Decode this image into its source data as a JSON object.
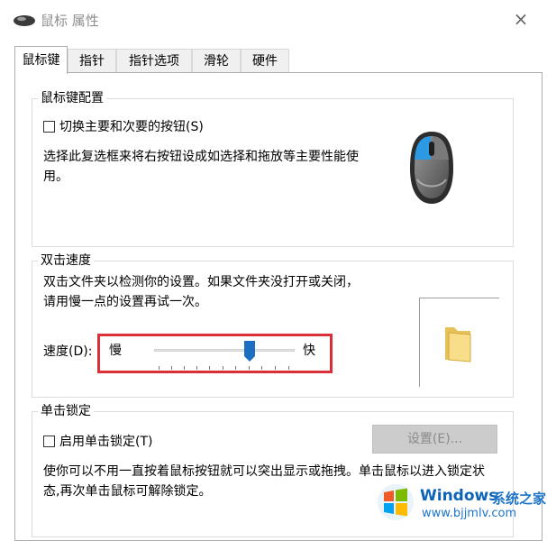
{
  "window": {
    "title": "鼠标 属性",
    "close_glyph": "×"
  },
  "tabs": [
    {
      "label": "鼠标键",
      "active": true
    },
    {
      "label": "指针"
    },
    {
      "label": "指针选项"
    },
    {
      "label": "滑轮"
    },
    {
      "label": "硬件"
    }
  ],
  "button_config": {
    "group_title": "鼠标键配置",
    "checkbox_label": "切换主要和次要的按钮(S)",
    "checked": false,
    "description": "选择此复选框来将右按钮设成如选择和拖放等主要性能使用。",
    "icon": "mouse-icon"
  },
  "double_click": {
    "group_title": "双击速度",
    "description": "双击文件夹以检测你的设置。如果文件夹没打开或关闭，请用慢一点的设置再试一次。",
    "speed_label": "速度(D):",
    "slow_label": "慢",
    "fast_label": "快",
    "slider_value_fraction": 0.69,
    "slider_ticks": 11,
    "folder_icon": "folder-icon"
  },
  "click_lock": {
    "group_title": "单击锁定",
    "checkbox_label": "启用单击锁定(T)",
    "checked": false,
    "settings_button": "设置(E)...",
    "settings_disabled": true,
    "description": "使你可以不用一直按着鼠标按钮就可以突出显示或拖拽。单击鼠标以进入锁定状态,再次单击鼠标可解除锁定。"
  },
  "watermark": {
    "brand": "Windows",
    "cn_text": "系统之家",
    "url": "www.bjjmlv.com",
    "icon": "windows-logo-icon"
  },
  "colors": {
    "highlight_box": "#d92f37",
    "slider_thumb": "#1b6ec2",
    "mouse_accent": "#2b9ae3",
    "watermark_blue": "#0d63b8"
  }
}
